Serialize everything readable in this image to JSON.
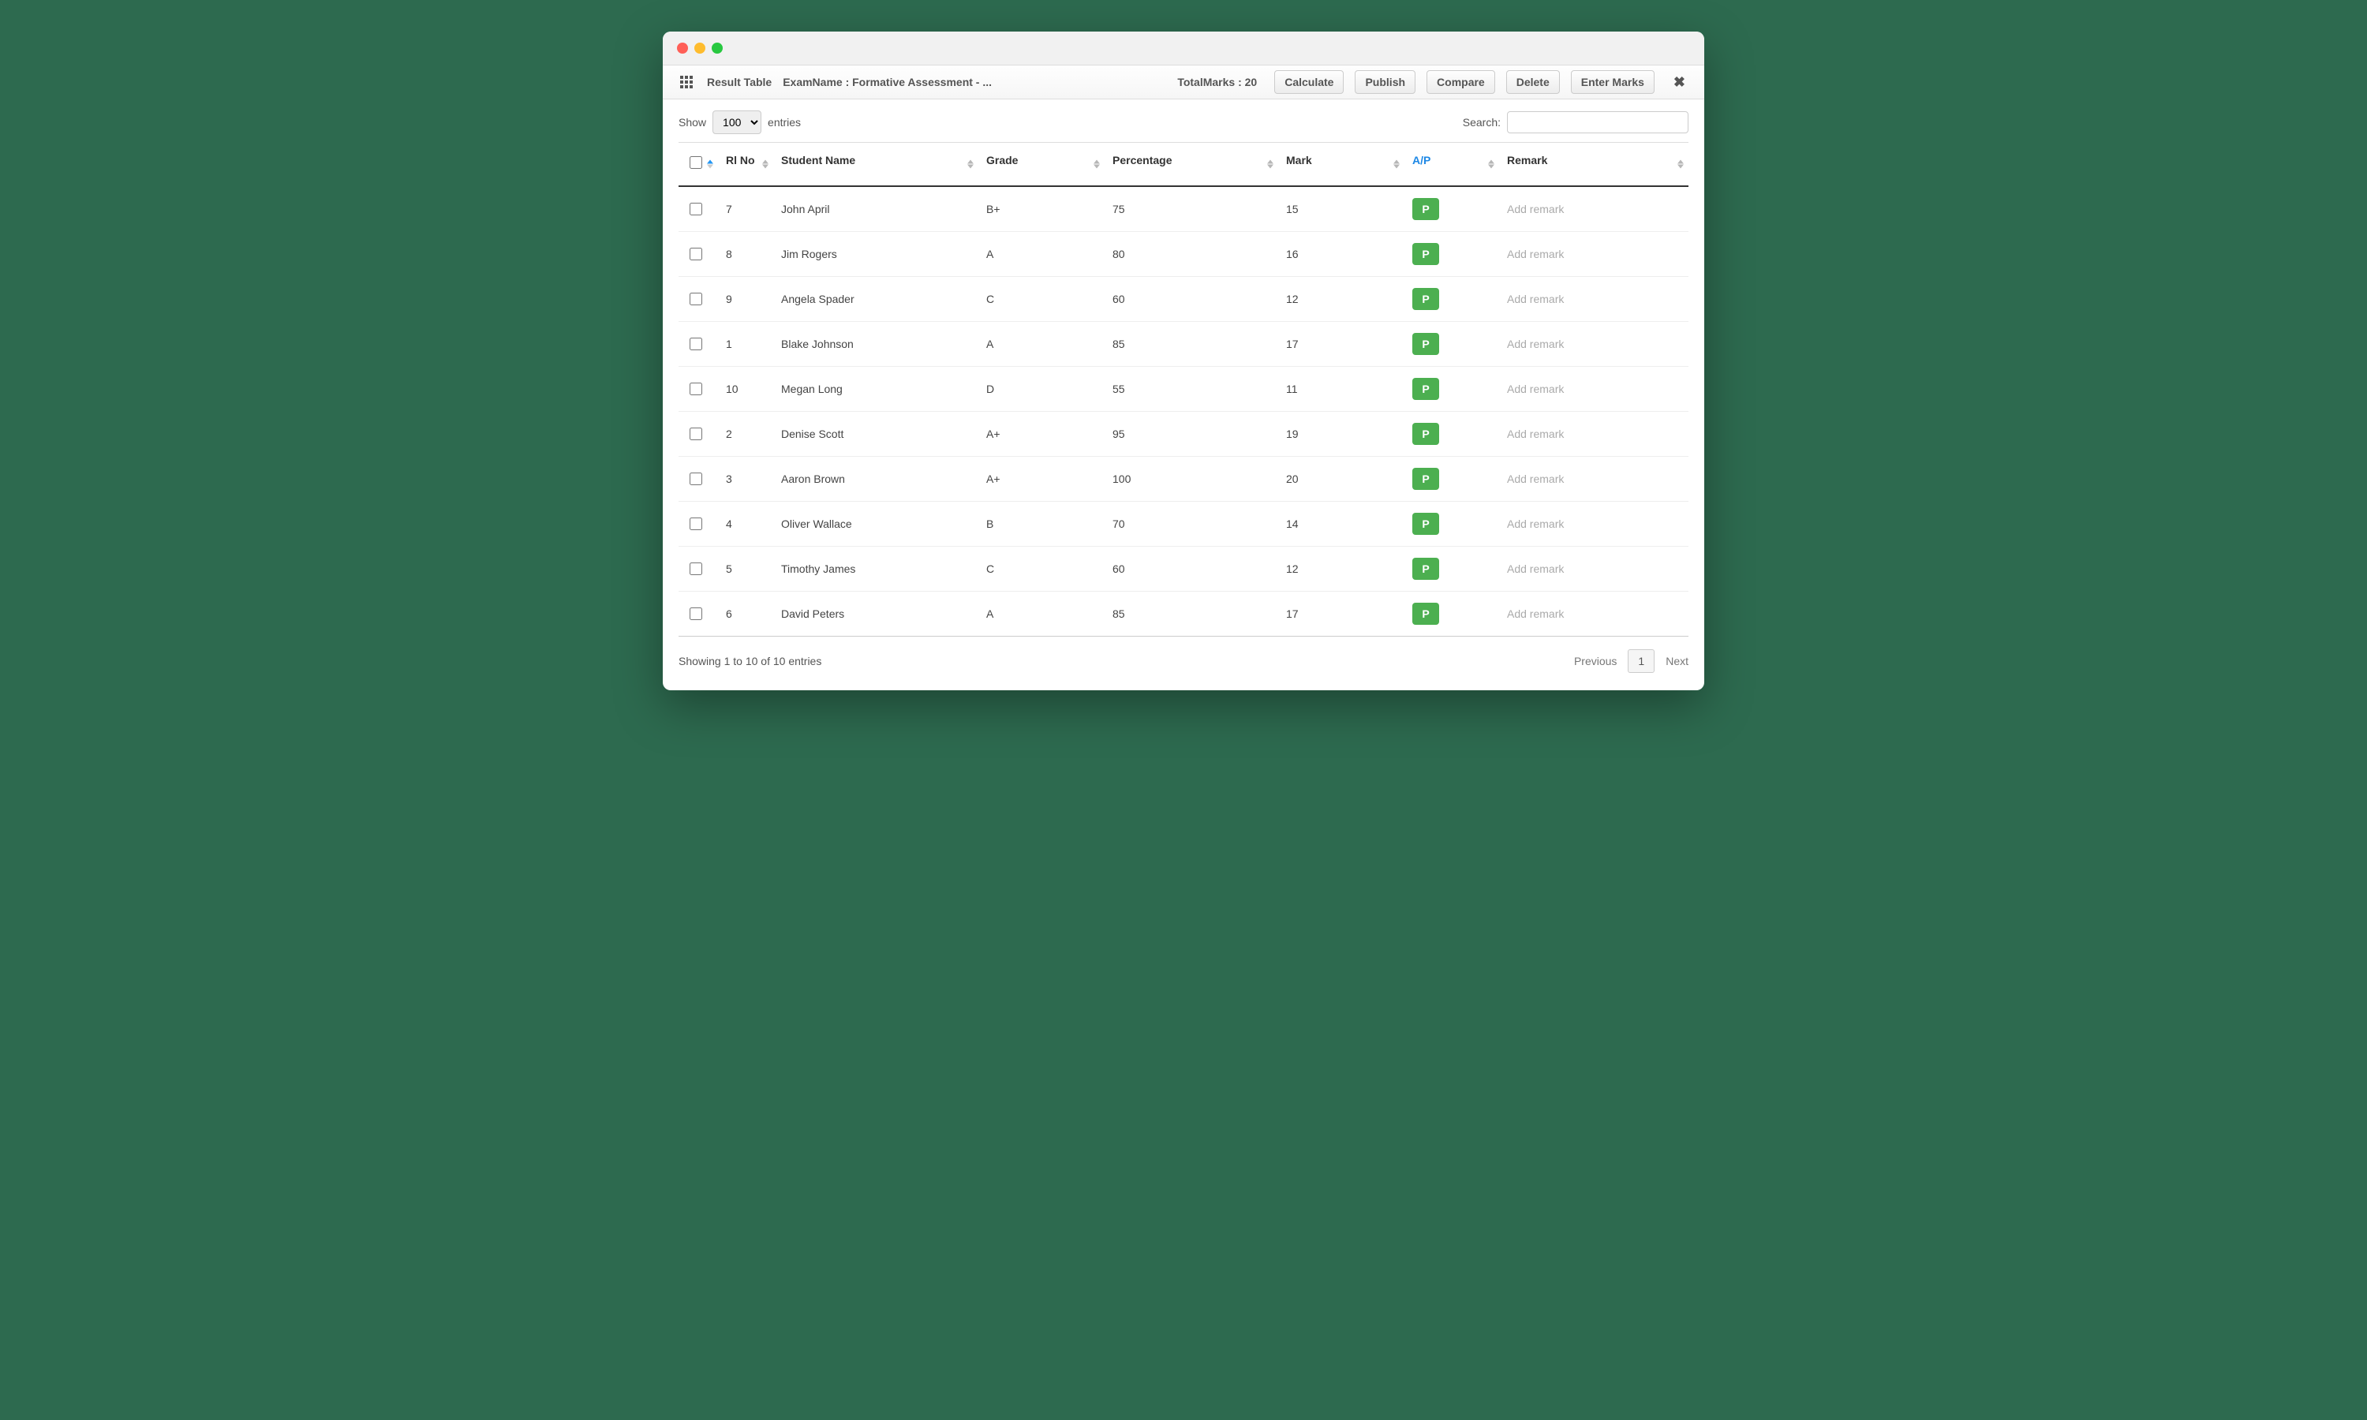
{
  "toolbar": {
    "title": "Result Table",
    "exam_label": "ExamName : Formative Assessment - ...",
    "total_marks": "TotalMarks : 20",
    "buttons": {
      "calculate": "Calculate",
      "publish": "Publish",
      "compare": "Compare",
      "delete": "Delete",
      "enter_marks": "Enter Marks"
    }
  },
  "controls": {
    "show_label_pre": "Show",
    "show_value": "100",
    "show_label_post": "entries",
    "search_label": "Search:"
  },
  "columns": {
    "checkbox": "",
    "rlno": "Rl No",
    "student": "Student Name",
    "grade": "Grade",
    "percentage": "Percentage",
    "mark": "Mark",
    "ap": "A/P",
    "remark": "Remark"
  },
  "remark_placeholder": "Add remark",
  "rows": [
    {
      "rlno": "7",
      "student": "John April",
      "grade": "B+",
      "percentage": "75",
      "mark": "15",
      "ap": "P"
    },
    {
      "rlno": "8",
      "student": "Jim Rogers",
      "grade": "A",
      "percentage": "80",
      "mark": "16",
      "ap": "P"
    },
    {
      "rlno": "9",
      "student": "Angela Spader",
      "grade": "C",
      "percentage": "60",
      "mark": "12",
      "ap": "P"
    },
    {
      "rlno": "1",
      "student": "Blake Johnson",
      "grade": "A",
      "percentage": "85",
      "mark": "17",
      "ap": "P"
    },
    {
      "rlno": "10",
      "student": "Megan Long",
      "grade": "D",
      "percentage": "55",
      "mark": "11",
      "ap": "P"
    },
    {
      "rlno": "2",
      "student": "Denise Scott",
      "grade": "A+",
      "percentage": "95",
      "mark": "19",
      "ap": "P"
    },
    {
      "rlno": "3",
      "student": "Aaron Brown",
      "grade": "A+",
      "percentage": "100",
      "mark": "20",
      "ap": "P"
    },
    {
      "rlno": "4",
      "student": "Oliver Wallace",
      "grade": "B",
      "percentage": "70",
      "mark": "14",
      "ap": "P"
    },
    {
      "rlno": "5",
      "student": "Timothy James",
      "grade": "C",
      "percentage": "60",
      "mark": "12",
      "ap": "P"
    },
    {
      "rlno": "6",
      "student": "David Peters",
      "grade": "A",
      "percentage": "85",
      "mark": "17",
      "ap": "P"
    }
  ],
  "footer": {
    "info": "Showing 1 to 10 of 10 entries",
    "previous": "Previous",
    "page": "1",
    "next": "Next"
  }
}
